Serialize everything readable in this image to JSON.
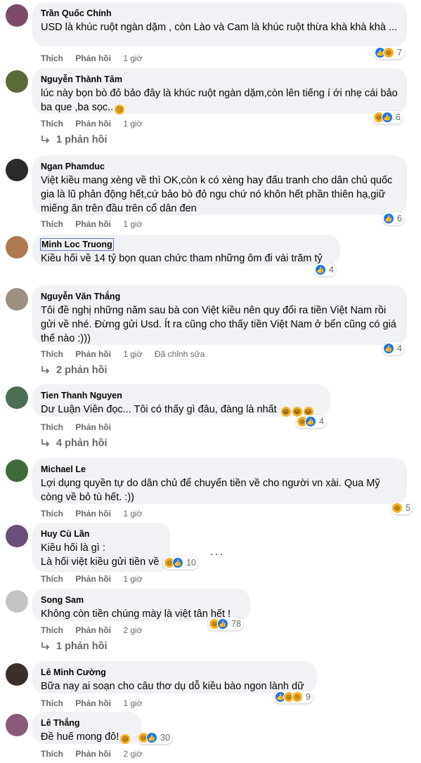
{
  "ui": {
    "like": "Thích",
    "reply": "Phản hồi"
  },
  "comments": [
    {
      "name": "Trần Quốc Chính",
      "text": "USD là khúc ruột ngàn dặm , còn Lào và Cam là khúc ruột thừa khà khà khà ...",
      "time": "1 giờ",
      "reactions": [
        "like",
        "haha"
      ],
      "count": "7"
    },
    {
      "name": "Nguyễn Thành Tâm",
      "text": "lúc này bọn bò đỏ bảo đây là khúc ruột ngàn dặm,còn lên tiếng í ới nhẹ cái bảo ba que ,ba sọc..",
      "time": "1 giờ",
      "reactions": [
        "haha",
        "like"
      ],
      "count": "6",
      "replies": "1 phản hồi"
    },
    {
      "name": "Ngan Phamduc",
      "text": "Việt kiều mang xèng về thì OK,còn k có xèng hay đấu tranh cho dân chủ quốc gia là lũ phản động hết,cứ bảo bò đỏ ngu chứ nó khôn hết phần thiên hạ,giữ miếng ăn trên đầu trên cổ dân đen",
      "time": "1 giờ",
      "reactions": [
        "like"
      ],
      "count": "6"
    },
    {
      "name": "Minh Loc Truong",
      "text": "Kiều hối về 14 tỷ bọn quan chức tham những ôm đi vài trăm tỷ",
      "time": "1 giờ",
      "reactions": [
        "like"
      ],
      "count": "4"
    },
    {
      "name": "Nguyễn Văn Thắng",
      "text": "Tôi đề nghị những năm sau bà con Việt kiều nên quy đổi ra tiền Việt Nam rồi gửi về nhé. Đừng gửi Usd. Ít ra cũng cho thấy tiền Việt Nam ở bển cũng có giá thế nào :)))",
      "time": "1 giờ",
      "edited": "Đã chỉnh sửa",
      "reactions": [
        "like"
      ],
      "count": "4",
      "replies": "2 phản hồi"
    },
    {
      "name": "Tien Thanh Nguyen",
      "text": "Dư Luận Viên đọc... Tôi có thấy gì đâu, đàng là nhất",
      "time": "",
      "reactions": [
        "haha",
        "like"
      ],
      "count": "4",
      "replies": "4 phản hồi"
    },
    {
      "name": "Michael Le",
      "text": "Lợi dụng quyền tự do dân chủ để chuyển tiền về cho người vn xài. Qua Mỹ còng về bỏ tù hết. :))",
      "time": "1 giờ",
      "reactions": [
        "haha"
      ],
      "count": "5"
    },
    {
      "name": "Huy Cù Lần",
      "text": "Kiều hối là gì :",
      "text2": "Là hối việt kiều gửi tiền về",
      "time": "1 giờ",
      "reactions": [
        "haha",
        "like"
      ],
      "count": "10",
      "more_icon": "more-dots-icon"
    },
    {
      "name": "Song Sam",
      "text": "Không còn tiền chúng mày là việt tân hết !",
      "time": "2 giờ",
      "reactions": [
        "haha",
        "like"
      ],
      "count": "78",
      "replies": "1 phản hồi"
    },
    {
      "name": "Lê Minh Cường",
      "text": "Bữa nay ai soạn cho câu thơ dụ dỗ kiều bào ngon lành dữ",
      "time": "1 giờ",
      "reactions": [
        "like",
        "haha",
        "sad"
      ],
      "count": "9"
    },
    {
      "name": "Lê Thắng",
      "text": "Đề huế mong đô!",
      "time": "2 giờ",
      "reactions": [
        "haha",
        "like"
      ],
      "count": "30"
    }
  ],
  "colors": {
    "bubble": "#f0f2f5",
    "meta": "#65676b",
    "like": "#1877f2",
    "haha": "#f7b125"
  }
}
